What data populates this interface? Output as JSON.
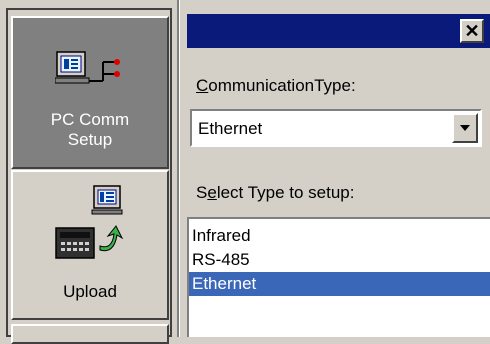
{
  "sidebar": {
    "items": [
      {
        "label_line1": "PC Comm",
        "label_line2": "Setup",
        "icon": "pc-comm-setup-icon",
        "active": true
      },
      {
        "label": "Upload",
        "icon": "upload-icon",
        "active": false
      }
    ]
  },
  "dialog": {
    "close_label": "✕",
    "comm_type_label_accel": "C",
    "comm_type_label_rest": "ommunicationType:",
    "comm_type_value": "Ethernet",
    "select_type_label_pre": "S",
    "select_type_label_accel": "e",
    "select_type_label_rest": "lect Type to setup:",
    "setup_types": [
      "Infrared",
      "RS-485",
      "Ethernet"
    ],
    "selected_setup_type": "Ethernet"
  },
  "colors": {
    "titlebar": "#0a1a7a",
    "selection": "#3a67b8",
    "active_sidebar": "#808080",
    "face": "#d4d0c8"
  }
}
